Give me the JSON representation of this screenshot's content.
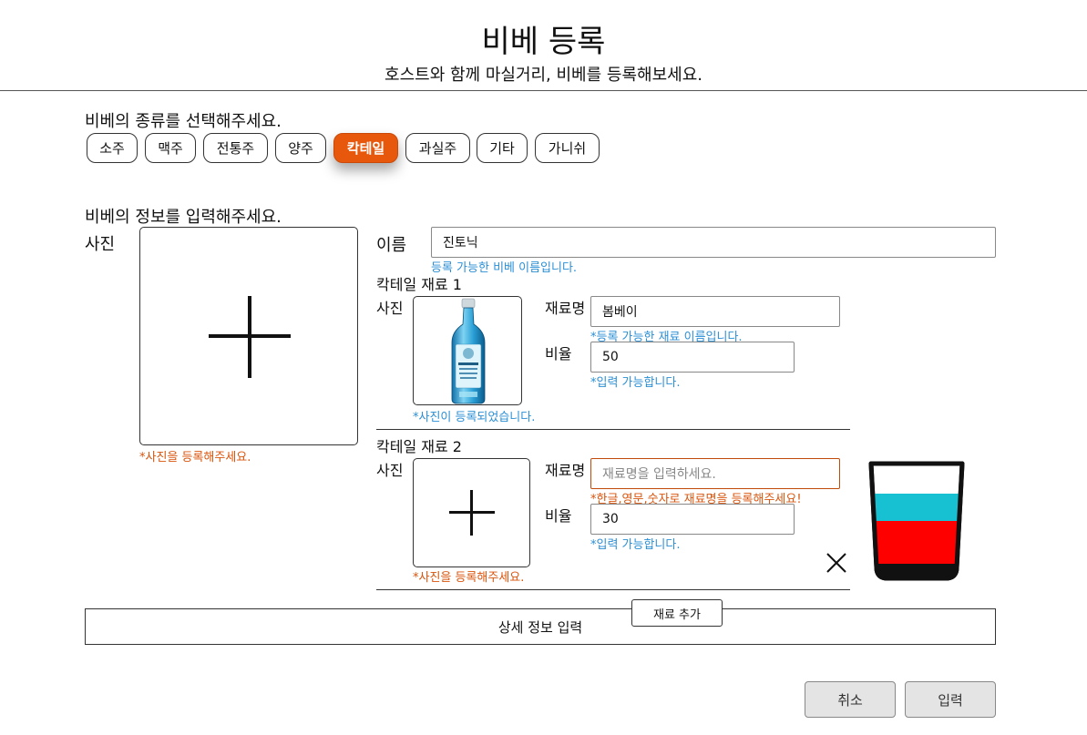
{
  "header": {
    "title": "비베 등록",
    "subtitle": "호스트와 함께 마실거리, 비베를 등록해보세요."
  },
  "type_section": {
    "label": "비베의 종류를 선택해주세요.",
    "types": [
      "소주",
      "맥주",
      "전통주",
      "양주",
      "칵테일",
      "과실주",
      "기타",
      "가니쉬"
    ],
    "selected": "칵테일",
    "accent_color": "#e8580c"
  },
  "info_section": {
    "label": "비베의 정보를 입력해주세요.",
    "photo_label": "사진",
    "photo_error": "*사진을 등록해주세요.",
    "name_label": "이름",
    "name_value": "진토닉",
    "name_message": "등록 가능한 비베 이름입니다."
  },
  "ingredients": [
    {
      "title": "칵테일 재료 1",
      "photo_label": "사진",
      "photo_message": "*사진이 등록되었습니다.",
      "name_label": "재료명",
      "name_value": "봄베이",
      "name_placeholder": "",
      "name_message": "*등록 가능한 재료 이름입니다.",
      "ratio_label": "비율",
      "ratio_value": "50",
      "ratio_message": "*입력 가능합니다.",
      "photo_icon": "gin-bottle-image"
    },
    {
      "title": "칵테일 재료 2",
      "photo_label": "사진",
      "photo_message": "*사진을 등록해주세요.",
      "name_label": "재료명",
      "name_value": "",
      "name_placeholder": "재료명을 입력하세요.",
      "name_message": "*한글,영문,숫자로 재료명을 등록해주세요!",
      "ratio_label": "비율",
      "ratio_value": "30",
      "ratio_message": "*입력 가능합니다.",
      "photo_icon": "plus-icon"
    }
  ],
  "glass_preview": {
    "icon": "cocktail-glass-icon",
    "top_layer_color": "#17c1d1",
    "bottom_layer_color": "#ff0000",
    "top_ratio": 30,
    "bottom_ratio": 50
  },
  "actions": {
    "add_ingredient": "재료 추가",
    "detail_input": "상세 정보 입력",
    "cancel": "취소",
    "submit": "입력"
  }
}
